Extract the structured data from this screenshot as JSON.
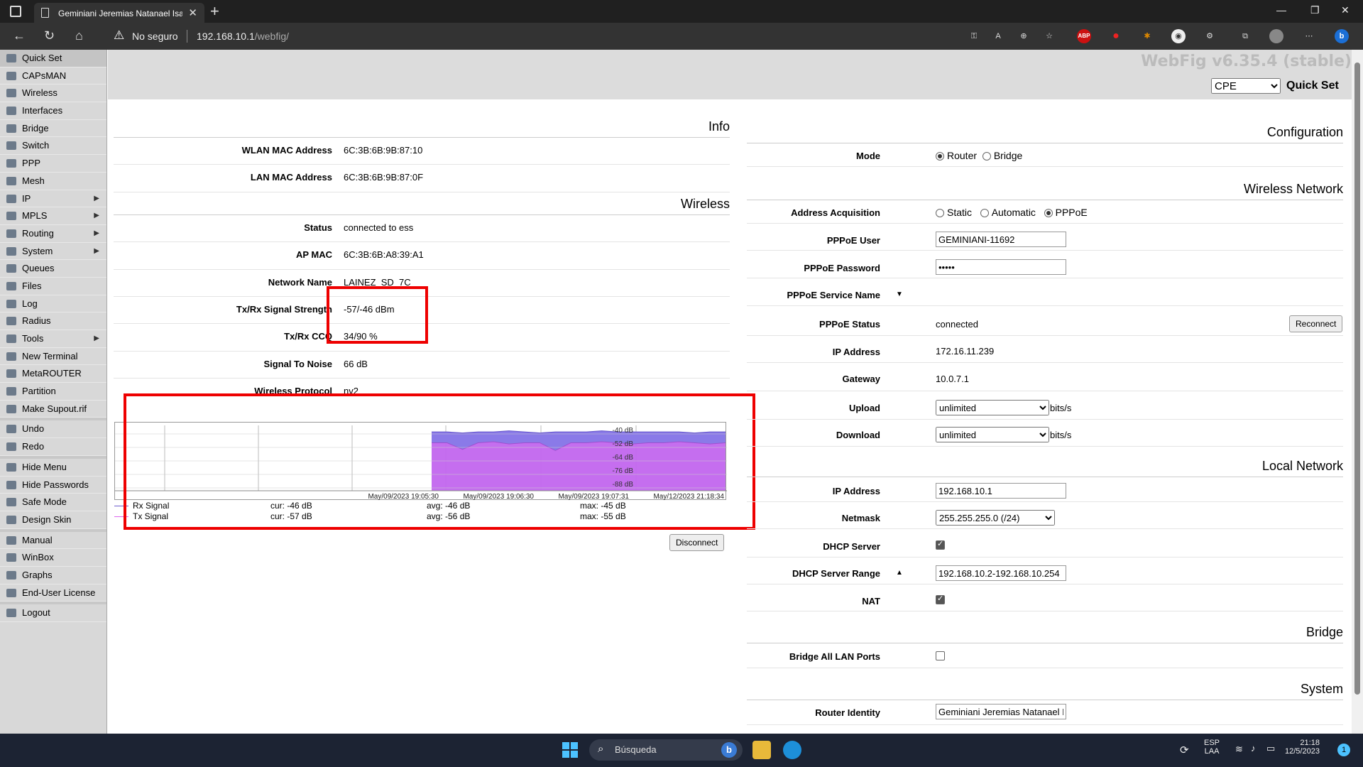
{
  "browser": {
    "tab_title": "Geminiani Jeremias Natanael Isa",
    "security_label": "No seguro",
    "url_host": "192.168.10.1",
    "url_path": "/webfig/",
    "extensions": [
      "key-icon",
      "read-aloud-icon",
      "zoom-icon",
      "favorites-icon",
      "ABP",
      "record-icon",
      "puzzle-icon",
      "profile-icon",
      "collections-icon",
      "avatar-icon",
      "more-icon",
      "bing-icon"
    ]
  },
  "header": {
    "webfig_version": "WebFig v6.35.4 (stable)",
    "mode_value": "CPE",
    "mode_options": [
      "CPE"
    ],
    "page_title": "Quick Set"
  },
  "menu": [
    {
      "label": "Quick Set",
      "sel": true
    },
    {
      "label": "CAPsMAN"
    },
    {
      "label": "Wireless"
    },
    {
      "label": "Interfaces"
    },
    {
      "label": "Bridge"
    },
    {
      "label": "Switch"
    },
    {
      "label": "PPP"
    },
    {
      "label": "Mesh"
    },
    {
      "label": "IP",
      "sub": true
    },
    {
      "label": "MPLS",
      "sub": true
    },
    {
      "label": "Routing",
      "sub": true
    },
    {
      "label": "System",
      "sub": true
    },
    {
      "label": "Queues"
    },
    {
      "label": "Files"
    },
    {
      "label": "Log"
    },
    {
      "label": "Radius"
    },
    {
      "label": "Tools",
      "sub": true
    },
    {
      "label": "New Terminal"
    },
    {
      "label": "MetaROUTER"
    },
    {
      "label": "Partition"
    },
    {
      "label": "Make Supout.rif"
    },
    {
      "gap": true
    },
    {
      "label": "Undo"
    },
    {
      "label": "Redo"
    },
    {
      "gap": true
    },
    {
      "label": "Hide Menu"
    },
    {
      "label": "Hide Passwords"
    },
    {
      "label": "Safe Mode"
    },
    {
      "label": "Design Skin"
    },
    {
      "gap": true
    },
    {
      "label": "Manual"
    },
    {
      "label": "WinBox"
    },
    {
      "label": "Graphs"
    },
    {
      "label": "End-User License"
    },
    {
      "gap": true
    },
    {
      "label": "Logout"
    }
  ],
  "info": {
    "title": "Info",
    "wlan_mac_label": "WLAN MAC Address",
    "wlan_mac": "6C:3B:6B:9B:87:10",
    "lan_mac_label": "LAN MAC Address",
    "lan_mac": "6C:3B:6B:9B:87:0F"
  },
  "wireless": {
    "title": "Wireless",
    "status_label": "Status",
    "status": "connected to ess",
    "ap_mac_label": "AP MAC",
    "ap_mac": "6C:3B:6B:A8:39:A1",
    "network_name_label": "Network Name",
    "network_name": "LAINEZ_SD_7C",
    "signal_label": "Tx/Rx Signal Strength",
    "signal": "-57/-46 dBm",
    "ccq_label": "Tx/Rx CCQ",
    "ccq": "34/90 %",
    "snr_label": "Signal To Noise",
    "snr": "66 dB",
    "protocol_label": "Wireless Protocol",
    "protocol": "nv2",
    "disconnect_label": "Disconnect"
  },
  "chart_data": {
    "type": "area",
    "x_ticks": [
      "May/09/2023 19:05:30",
      "May/09/2023 19:06:30",
      "May/09/2023 19:07:31",
      "May/12/2023 21:18:34"
    ],
    "y_ticks": [
      "-40 dB",
      "-52 dB",
      "-64 dB",
      "-76 dB",
      "-88 dB"
    ],
    "ylim": [
      -100,
      -40
    ],
    "series": [
      {
        "name": "Rx Signal",
        "color": "#6a5acd",
        "cur": "cur: -46 dB",
        "avg": "avg: -46 dB",
        "max": "max: -45 dB",
        "values": [
          -46,
          -46,
          -47,
          -46,
          -46,
          -45,
          -46,
          -47,
          -46,
          -46,
          -46,
          -45,
          -46,
          -46,
          -46,
          -46,
          -46,
          -47,
          -46,
          -46
        ]
      },
      {
        "name": "Tx Signal",
        "color": "#dd66ee",
        "cur": "cur: -57 dB",
        "avg": "avg: -56 dB",
        "max": "max: -55 dB",
        "values": [
          -56,
          -56,
          -62,
          -56,
          -55,
          -57,
          -56,
          -56,
          -63,
          -56,
          -56,
          -55,
          -56,
          -57,
          -56,
          -56,
          -55,
          -56,
          -57,
          -56
        ]
      }
    ]
  },
  "configuration": {
    "title": "Configuration",
    "mode_label": "Mode",
    "mode_router": "Router",
    "mode_bridge": "Bridge"
  },
  "wireless_network": {
    "title": "Wireless Network",
    "acq_label": "Address Acquisition",
    "acq_static": "Static",
    "acq_auto": "Automatic",
    "acq_pppoe": "PPPoE",
    "pppoe_user_label": "PPPoE User",
    "pppoe_user": "GEMINIANI-11692",
    "pppoe_pass_label": "PPPoE Password",
    "pppoe_pass": "•••••",
    "pppoe_service_label": "PPPoE Service Name",
    "pppoe_status_label": "PPPoE Status",
    "pppoe_status": "connected",
    "reconnect_label": "Reconnect",
    "ip_label": "IP Address",
    "ip": "172.16.11.239",
    "gw_label": "Gateway",
    "gw": "10.0.7.1",
    "upload_label": "Upload",
    "upload": "unlimited",
    "download_label": "Download",
    "download": "unlimited",
    "unit": "bits/s"
  },
  "local_network": {
    "title": "Local Network",
    "ip_label": "IP Address",
    "ip": "192.168.10.1",
    "netmask_label": "Netmask",
    "netmask": "255.255.255.0 (/24)",
    "dhcp_label": "DHCP Server",
    "dhcp_range_label": "DHCP Server Range",
    "dhcp_range": "192.168.10.2-192.168.10.254",
    "nat_label": "NAT"
  },
  "bridge": {
    "title": "Bridge",
    "all_ports_label": "Bridge All LAN Ports"
  },
  "system": {
    "title": "System",
    "identity_label": "Router Identity",
    "identity": "Geminiani Jeremias Natanael Isa"
  },
  "taskbar": {
    "search": "Búsqueda",
    "lang1": "ESP",
    "lang2": "LAA",
    "time": "21:18",
    "date": "12/5/2023",
    "notif": "1"
  },
  "colors": {
    "highlight": "#e00000",
    "chart_rx": "#6a5acd",
    "chart_tx": "#dd66ee"
  }
}
